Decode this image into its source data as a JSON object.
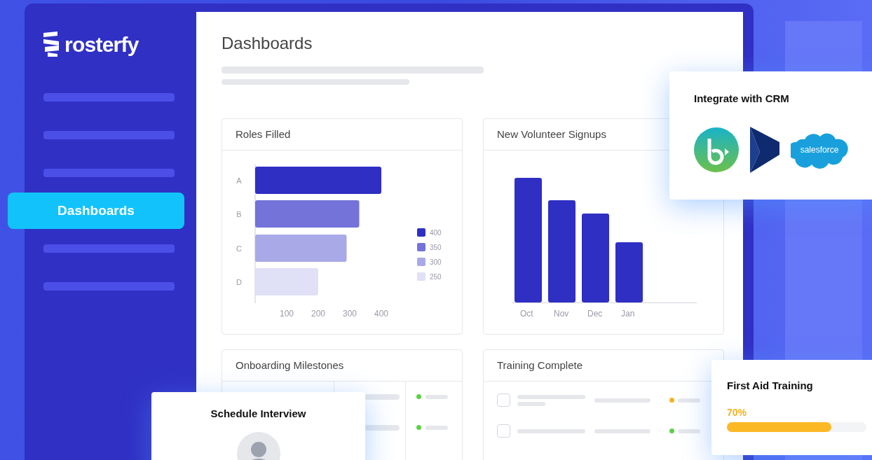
{
  "sidebar": {
    "logo": "rosterfy",
    "items": [
      {
        "kind": "skeleton",
        "selected": false
      },
      {
        "kind": "skeleton",
        "selected": false
      },
      {
        "kind": "skeleton",
        "selected": false
      },
      {
        "kind": "link",
        "label": "Dashboards",
        "selected": true
      },
      {
        "kind": "skeleton",
        "selected": false
      },
      {
        "kind": "skeleton",
        "selected": false
      }
    ]
  },
  "page": {
    "title": "Dashboards"
  },
  "cards": [
    {
      "kind": "roles",
      "title": "Roles Filled",
      "chart_data": {
        "type": "bar",
        "orientation": "horizontal",
        "categories": [
          "A",
          "B",
          "C",
          "D"
        ],
        "series": [
          {
            "name": "400",
            "color": "#2f2fc4",
            "values": [
              400,
              null,
              null,
              null
            ]
          },
          {
            "name": "350",
            "color": "#7373d9",
            "values": [
              null,
              330,
              null,
              null
            ]
          },
          {
            "name": "300",
            "color": "#a9a9e8",
            "values": [
              null,
              null,
              290,
              null
            ]
          },
          {
            "name": "250",
            "color": "#e0e0f6",
            "values": [
              null,
              null,
              null,
              200
            ]
          }
        ],
        "xticks": [
          100,
          200,
          300,
          400
        ],
        "xlim": [
          0,
          400
        ],
        "legend": "right"
      }
    },
    {
      "kind": "signups",
      "title": "New Volunteer Signups",
      "x_labels": [
        "Oct",
        "Nov",
        "Dec",
        "Jan"
      ]
    },
    {
      "kind": "milestones",
      "title": "Onboarding Milestones",
      "rows": [
        {
          "color": "#5cd14a"
        },
        {
          "color": "#5cd14a"
        }
      ]
    },
    {
      "kind": "training",
      "title": "Training Complete",
      "rows": [
        {
          "checked": false,
          "color": "#f5b324"
        },
        {
          "checked": false,
          "color": "#5cd14a"
        }
      ]
    }
  ],
  "crm_card": {
    "title": "Integrate with CRM",
    "logos": [
      {
        "kind": "b-circle"
      },
      {
        "kind": "arrow"
      },
      {
        "kind": "cloud",
        "label": "salesforce"
      }
    ]
  },
  "interview_card": {
    "title": "Schedule Interview"
  },
  "training_card": {
    "title": "First Aid Training",
    "reading": "70%",
    "level": 0.75
  }
}
